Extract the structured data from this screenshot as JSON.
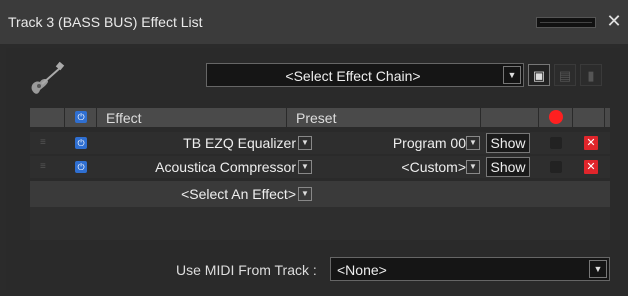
{
  "window": {
    "title": "Track 3 (BASS BUS) Effect List",
    "close_symbol": "✕"
  },
  "toolbar": {
    "chain_select_label": "<Select Effect Chain>",
    "save_icon": "floppy-icon",
    "load_icon": "load-icon",
    "new_icon": "document-icon"
  },
  "table": {
    "header_effect": "Effect",
    "header_preset": "Preset",
    "rows": [
      {
        "effect": "TB EZQ Equalizer",
        "preset": "Program 00",
        "show_label": "Show"
      },
      {
        "effect": "Acoustica Compressor",
        "preset": "<Custom>",
        "show_label": "Show"
      }
    ],
    "select_effect_label": "<Select An Effect>"
  },
  "midi": {
    "label": "Use MIDI From Track :",
    "value": "<None>"
  },
  "colors": {
    "power_blue": "#2f6fd1",
    "record_red": "#ff2020",
    "delete_red": "#e0252b"
  }
}
